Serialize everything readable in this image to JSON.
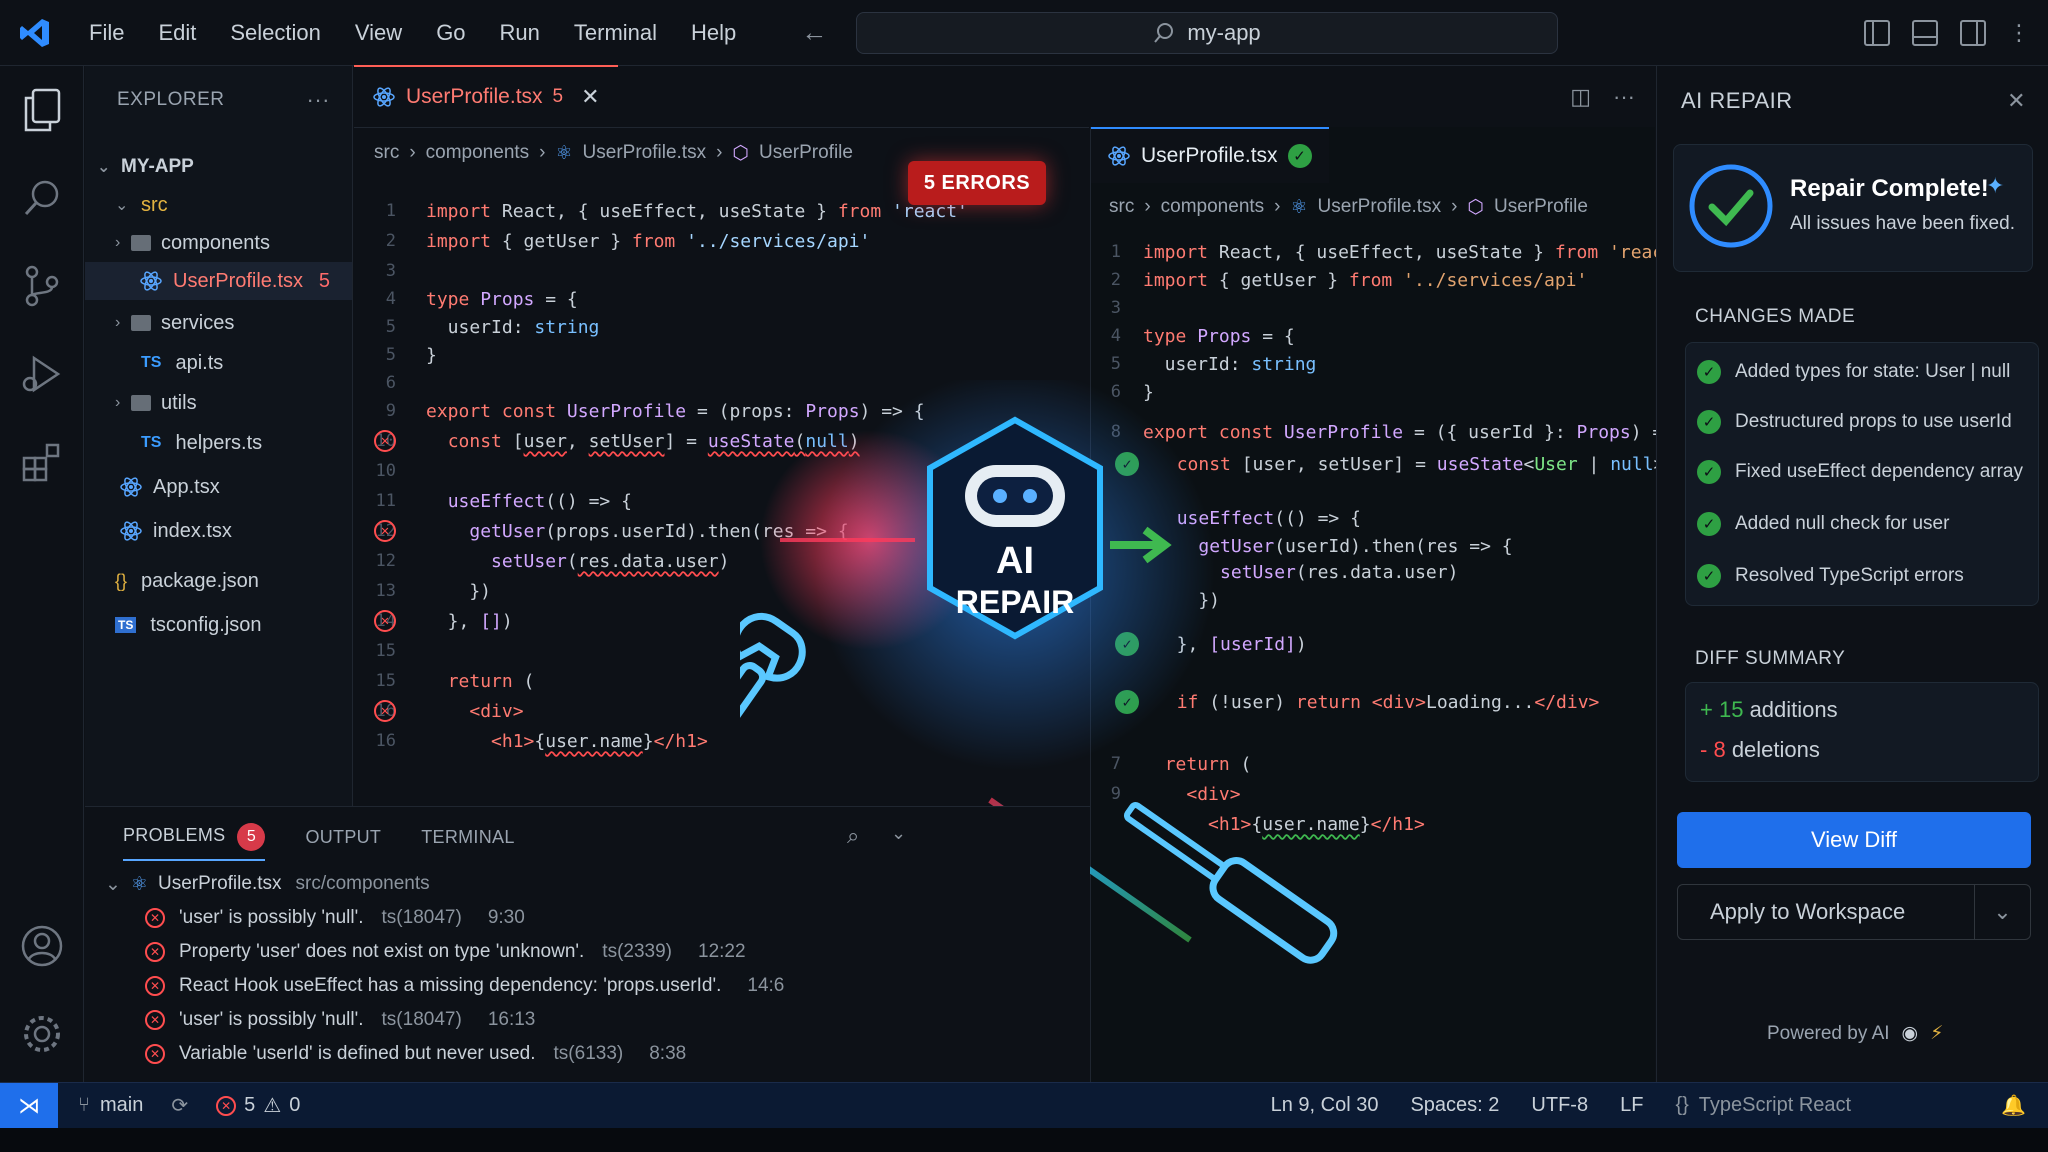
{
  "menu": [
    "File",
    "Edit",
    "Selection",
    "View",
    "Go",
    "Run",
    "Terminal",
    "Help"
  ],
  "search": {
    "text": "my-app"
  },
  "explorer": {
    "title": "EXPLORER",
    "root": "MY-APP",
    "items": [
      {
        "label": "src",
        "type": "folder-open"
      },
      {
        "label": "components",
        "type": "folder"
      },
      {
        "label": "UserProfile.tsx",
        "type": "react",
        "badge": "5"
      },
      {
        "label": "services",
        "type": "folder"
      },
      {
        "label": "api.ts",
        "type": "ts",
        "icon": "TS"
      },
      {
        "label": "utils",
        "type": "folder"
      },
      {
        "label": "helpers.ts",
        "type": "ts",
        "icon": "TS"
      },
      {
        "label": "App.tsx",
        "type": "react"
      },
      {
        "label": "index.tsx",
        "type": "react"
      },
      {
        "label": "package.json",
        "type": "json",
        "icon": "{}"
      },
      {
        "label": "tsconfig.json",
        "type": "tsconfig",
        "icon": "TS"
      }
    ]
  },
  "left_editor": {
    "tab": {
      "label": "UserProfile.tsx",
      "badge": "5"
    },
    "breadcrumb": [
      "src",
      "components",
      "UserProfile.tsx",
      "UserProfile"
    ],
    "errors_badge": "5 ERRORS",
    "line_numbers": [
      "1",
      "2",
      "3",
      "4",
      "5",
      "5",
      "6",
      "9",
      "10",
      "10",
      "11",
      "12",
      "12",
      "13",
      "14",
      "15",
      "15",
      "16"
    ]
  },
  "right_editor": {
    "tab": {
      "label": "UserProfile.tsx"
    },
    "breadcrumb": [
      "src",
      "components",
      "UserProfile.tsx",
      "UserProfile"
    ],
    "line_numbers": [
      "1",
      "2",
      "3",
      "4",
      "5",
      "6",
      "8",
      "9",
      "10",
      "11",
      "12",
      "13",
      "14",
      "15",
      "7",
      "9"
    ]
  },
  "hero": {
    "line1": "AI",
    "line2": "REPAIR"
  },
  "problems": {
    "tabs": [
      "PROBLEMS",
      "OUTPUT",
      "TERMINAL"
    ],
    "count": "5",
    "file": "UserProfile.tsx",
    "path": "src/components",
    "items": [
      {
        "msg": "'user' is possibly 'null'.",
        "code": "ts(18047)",
        "pos": "9:30"
      },
      {
        "msg": "Property 'user' does not exist on type 'unknown'.",
        "code": "ts(2339)",
        "pos": "12:22"
      },
      {
        "msg": "React Hook useEffect has a missing dependency: 'props.userId'.",
        "code": "",
        "pos": "14:6"
      },
      {
        "msg": "'user' is possibly 'null'.",
        "code": "ts(18047)",
        "pos": "16:13"
      },
      {
        "msg": "Variable 'userId' is defined but never used.",
        "code": "ts(6133)",
        "pos": "8:38"
      }
    ]
  },
  "ai_panel": {
    "title": "AI REPAIR",
    "status_title": "Repair Complete!",
    "status_sub": "All issues have been fixed.",
    "changes_title": "CHANGES MADE",
    "changes": [
      "Added types for state: User | null",
      "Destructured props to use userId",
      "Fixed useEffect dependency array",
      "Added null check for user",
      "Resolved TypeScript errors"
    ],
    "diff_title": "DIFF SUMMARY",
    "additions_count": "+ 15",
    "additions_label": "additions",
    "deletions_count": "- 8",
    "deletions_label": "deletions",
    "view_diff": "View Diff",
    "apply": "Apply to Workspace",
    "powered": "Powered by AI"
  },
  "statusbar": {
    "branch": "main",
    "errors": "5",
    "warnings": "0",
    "position": "Ln 9, Col 30",
    "spaces": "Spaces: 2",
    "encoding": "UTF-8",
    "eol": "LF",
    "language": "TypeScript React"
  },
  "colors": {
    "accent": "#1f6feb",
    "error": "#ff4d4f",
    "success": "#2ea043"
  }
}
